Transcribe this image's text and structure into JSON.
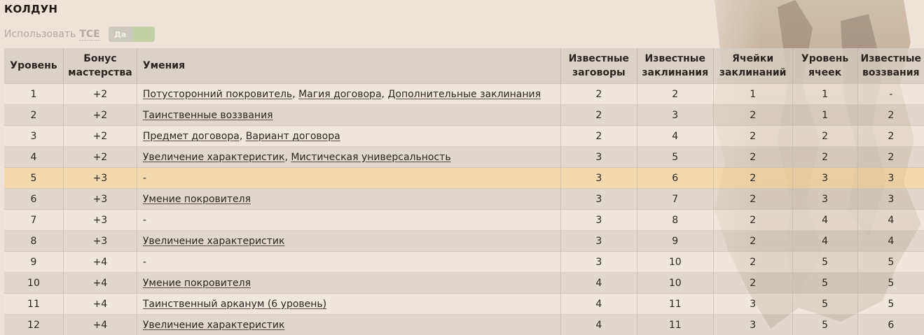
{
  "title": "КОЛДУН",
  "tce": {
    "label": "Использовать",
    "abbr": "TCE",
    "toggle_label": "Да"
  },
  "columns": [
    "Уровень",
    "Бонус мастерства",
    "Умения",
    "Известные заговоры",
    "Известные заклинания",
    "Ячейки заклинаний",
    "Уровень ячеек",
    "Известные воззвания"
  ],
  "rows": [
    {
      "level": "1",
      "bonus": "+2",
      "features": [
        "Потусторонний покровитель",
        "Магия договора",
        "Дополнительные заклинания"
      ],
      "cantrips": "2",
      "spells": "2",
      "slots": "1",
      "slot_level": "1",
      "invocations": "-"
    },
    {
      "level": "2",
      "bonus": "+2",
      "features": [
        "Таинственные воззвания"
      ],
      "cantrips": "2",
      "spells": "3",
      "slots": "2",
      "slot_level": "1",
      "invocations": "2"
    },
    {
      "level": "3",
      "bonus": "+2",
      "features": [
        "Предмет договора",
        "Вариант договора"
      ],
      "cantrips": "2",
      "spells": "4",
      "slots": "2",
      "slot_level": "2",
      "invocations": "2"
    },
    {
      "level": "4",
      "bonus": "+2",
      "features": [
        "Увеличение характеристик",
        "Мистическая универсальность"
      ],
      "cantrips": "3",
      "spells": "5",
      "slots": "2",
      "slot_level": "2",
      "invocations": "2"
    },
    {
      "level": "5",
      "bonus": "+3",
      "features": [],
      "cantrips": "3",
      "spells": "6",
      "slots": "2",
      "slot_level": "3",
      "invocations": "3"
    },
    {
      "level": "6",
      "bonus": "+3",
      "features": [
        "Умение покровителя"
      ],
      "cantrips": "3",
      "spells": "7",
      "slots": "2",
      "slot_level": "3",
      "invocations": "3"
    },
    {
      "level": "7",
      "bonus": "+3",
      "features": [],
      "cantrips": "3",
      "spells": "8",
      "slots": "2",
      "slot_level": "4",
      "invocations": "4"
    },
    {
      "level": "8",
      "bonus": "+3",
      "features": [
        "Увеличение характеристик"
      ],
      "cantrips": "3",
      "spells": "9",
      "slots": "2",
      "slot_level": "4",
      "invocations": "4"
    },
    {
      "level": "9",
      "bonus": "+4",
      "features": [],
      "cantrips": "3",
      "spells": "10",
      "slots": "2",
      "slot_level": "5",
      "invocations": "5"
    },
    {
      "level": "10",
      "bonus": "+4",
      "features": [
        "Умение покровителя"
      ],
      "cantrips": "4",
      "spells": "10",
      "slots": "2",
      "slot_level": "5",
      "invocations": "5"
    },
    {
      "level": "11",
      "bonus": "+4",
      "features": [
        "Таинственный арканум (6 уровень)"
      ],
      "cantrips": "4",
      "spells": "11",
      "slots": "3",
      "slot_level": "5",
      "invocations": "5"
    },
    {
      "level": "12",
      "bonus": "+4",
      "features": [
        "Увеличение характеристик"
      ],
      "cantrips": "4",
      "spells": "11",
      "slots": "3",
      "slot_level": "5",
      "invocations": "6"
    }
  ],
  "empty_feature": "-",
  "highlighted_level": "5"
}
